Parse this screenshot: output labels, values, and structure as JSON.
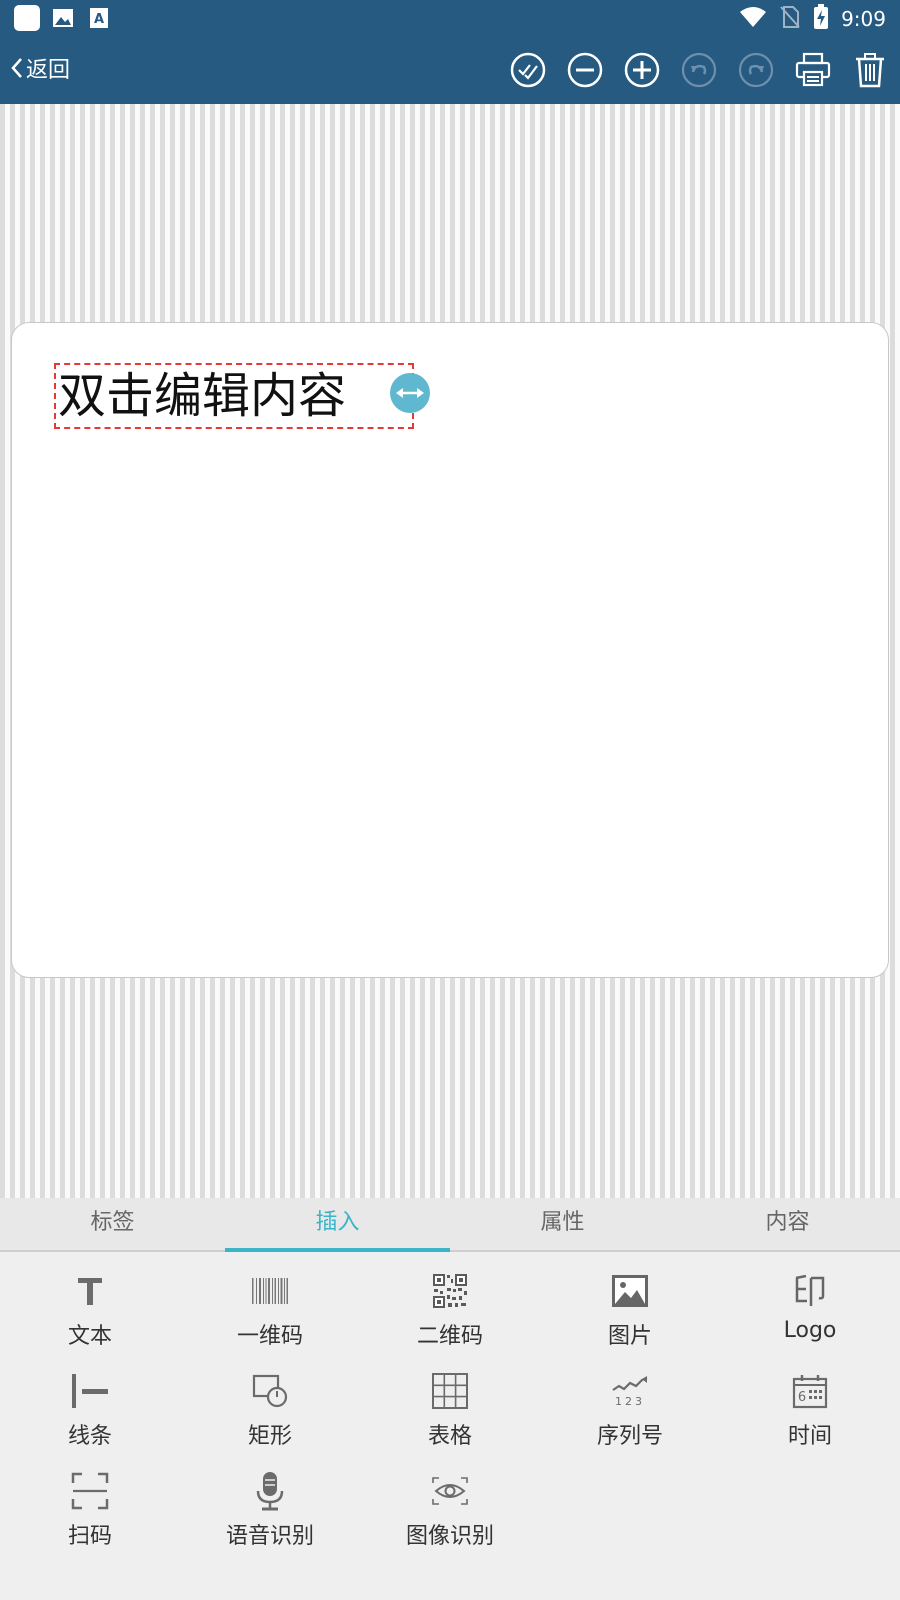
{
  "status": {
    "time": "9:09"
  },
  "toolbar": {
    "back_label": "返回",
    "icons": [
      "check-all-icon",
      "zoom-out-icon",
      "zoom-in-icon",
      "undo-icon",
      "redo-icon",
      "print-icon",
      "trash-icon"
    ]
  },
  "canvas": {
    "text_element": "双击编辑内容"
  },
  "tabs": [
    {
      "label": "标签"
    },
    {
      "label": "插入"
    },
    {
      "label": "属性"
    },
    {
      "label": "内容"
    }
  ],
  "tools": [
    {
      "label": "文本",
      "icon": "text-icon"
    },
    {
      "label": "一维码",
      "icon": "barcode-icon"
    },
    {
      "label": "二维码",
      "icon": "qrcode-icon"
    },
    {
      "label": "图片",
      "icon": "image-icon"
    },
    {
      "label": "Logo",
      "icon": "seal-icon"
    },
    {
      "label": "线条",
      "icon": "line-icon"
    },
    {
      "label": "矩形",
      "icon": "shape-icon"
    },
    {
      "label": "表格",
      "icon": "table-icon"
    },
    {
      "label": "序列号",
      "icon": "serial-number-icon"
    },
    {
      "label": "时间",
      "icon": "calendar-icon"
    },
    {
      "label": "扫码",
      "icon": "scan-icon"
    },
    {
      "label": "语音识别",
      "icon": "microphone-icon"
    },
    {
      "label": "图像识别",
      "icon": "eye-icon"
    }
  ],
  "colors": {
    "header": "#265a80",
    "accent": "#3bb4c8",
    "selection": "#e53935",
    "handle": "#5fb8cf"
  }
}
